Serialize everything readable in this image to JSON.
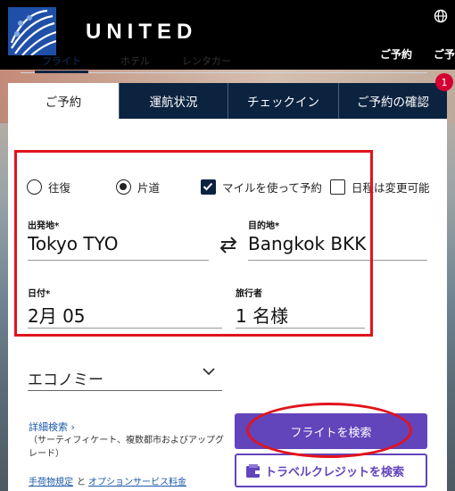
{
  "header": {
    "brand": "UNITED",
    "links": [
      "ご予約",
      "ご予"
    ]
  },
  "tabs": [
    {
      "label": "ご予約"
    },
    {
      "label": "運航状況"
    },
    {
      "label": "チェックイン"
    },
    {
      "label": "ご予約の確認",
      "badge": "1"
    }
  ],
  "subtabs": [
    "フライト",
    "ホテル",
    "レンタカー"
  ],
  "trip_type": {
    "roundtrip": "往復",
    "oneway": "片道",
    "selected": "oneway"
  },
  "options": {
    "miles": "マイルを使って予約",
    "miles_checked": true,
    "flexible": "日程は変更可能",
    "flexible_checked": false
  },
  "origin": {
    "label": "出発地*",
    "value": "Tokyo TYO"
  },
  "destination": {
    "label": "目的地*",
    "value": "Bangkok BKK"
  },
  "date": {
    "label": "日付*",
    "value": "2月 05"
  },
  "travelers": {
    "label": "旅行者",
    "value": "1 名様"
  },
  "cabin": {
    "value": "エコノミー"
  },
  "advanced": {
    "link": "詳細検索 ›",
    "note": "（サーティフィケート、複数都市およびアップグレード）"
  },
  "footer": {
    "baggage": "手荷物規定",
    "and": "と",
    "fees": "オプションサービス料金"
  },
  "buttons": {
    "search": "フライトを検索",
    "credit": "トラベルクレジットを検索"
  },
  "colors": {
    "navy": "#0c2340",
    "purple": "#6244bb",
    "alert": "#d50032",
    "highlight": "#e2131d"
  }
}
